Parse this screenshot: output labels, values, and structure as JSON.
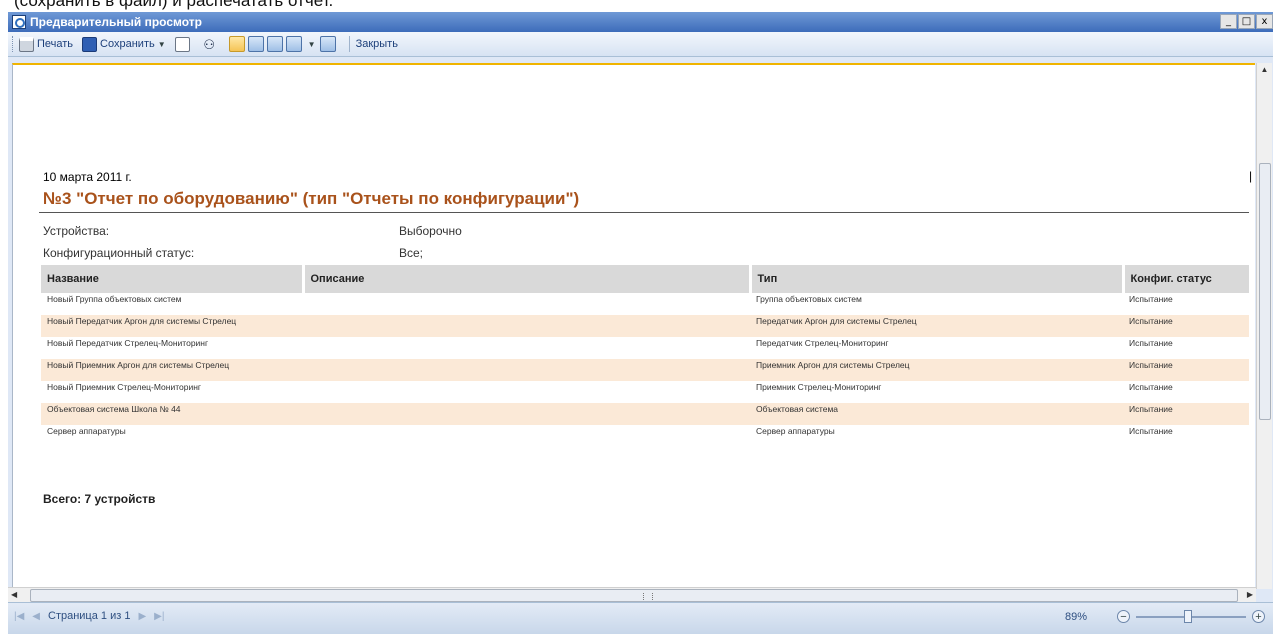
{
  "caption": "(сохранить в файл) и распечатать отчет.",
  "window": {
    "title": "Предварительный просмотр",
    "controls": [
      "_",
      "□",
      "x"
    ]
  },
  "toolbar": {
    "print_label": "Печать",
    "save_label": "Сохранить",
    "close_label": "Закрыть"
  },
  "report": {
    "date": "10 марта 2011 г.",
    "mark": "|",
    "title": "№3 \"Отчет по оборудованию\" (тип \"Отчеты по конфигурации\")",
    "params": [
      {
        "label": "Устройства:",
        "value": "Выборочно"
      },
      {
        "label": "Конфигурационный статус:",
        "value": "Все;"
      }
    ],
    "columns": [
      "Название",
      "Описание",
      "Тип",
      "Конфиг. статус"
    ],
    "rows": [
      {
        "name": "Новый Группа объектовых систем",
        "description": "",
        "type": "Группа объектовых систем",
        "status": "Испытание"
      },
      {
        "name": "Новый Передатчик Аргон для системы Стрелец",
        "description": "",
        "type": "Передатчик Аргон для системы Стрелец",
        "status": "Испытание"
      },
      {
        "name": "Новый Передатчик Стрелец-Мониторинг",
        "description": "",
        "type": "Передатчик Стрелец-Мониторинг",
        "status": "Испытание"
      },
      {
        "name": "Новый Приемник Аргон для системы Стрелец",
        "description": "",
        "type": "Приемник Аргон для системы Стрелец",
        "status": "Испытание"
      },
      {
        "name": "Новый Приемник Стрелец-Мониторинг",
        "description": "",
        "type": "Приемник Стрелец-Мониторинг",
        "status": "Испытание"
      },
      {
        "name": "Объектовая система Школа № 44",
        "description": "",
        "type": "Объектовая система",
        "status": "Испытание"
      },
      {
        "name": "Сервер аппаратуры",
        "description": "",
        "type": "Сервер аппаратуры",
        "status": "Испытание"
      }
    ],
    "total": "Всего: 7 устройств"
  },
  "statusbar": {
    "page_label": "Страница 1 из 1",
    "zoom": "89%"
  },
  "icons": [
    "preview-icon",
    "printer-icon",
    "save-icon",
    "page-icon",
    "binoculars-icon",
    "single-page-icon",
    "two-pages-icon",
    "three-pages-icon",
    "multi-pages-icon",
    "thumbnail-icon"
  ]
}
